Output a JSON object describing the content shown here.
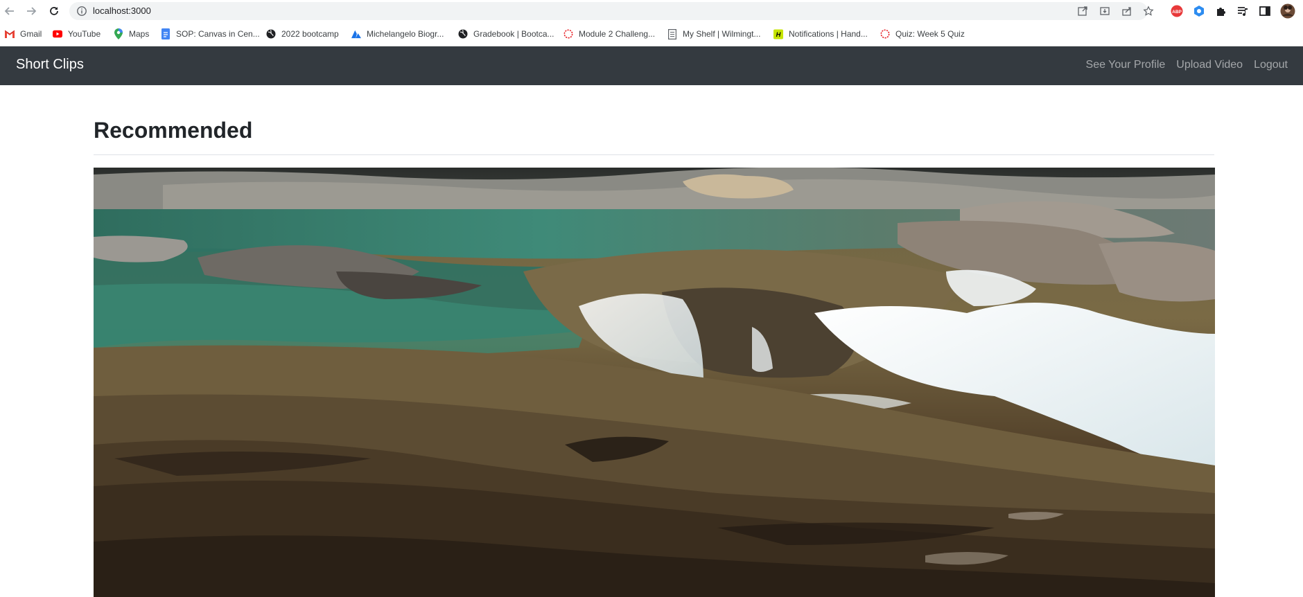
{
  "browser": {
    "url": "localhost:3000",
    "nav_icons": [
      "back-arrow-icon",
      "forward-arrow-icon",
      "reload-icon",
      "site-info-icon"
    ],
    "address_icons": [
      "open-in-app-icon",
      "install-icon",
      "share-icon",
      "star-icon"
    ],
    "extension_icons": [
      "adblock-plus-icon",
      "extension-blue-icon",
      "puzzle-icon",
      "media-queue-icon",
      "side-panel-icon",
      "profile-avatar"
    ],
    "bookmarks": [
      {
        "label": "Gmail",
        "icon": "gmail-icon",
        "color": "#ea4335"
      },
      {
        "label": "YouTube",
        "icon": "youtube-icon",
        "color": "#ff0000"
      },
      {
        "label": "Maps",
        "icon": "maps-icon",
        "color": "#34a853"
      },
      {
        "label": "SOP: Canvas in Cen...",
        "icon": "google-docs-icon",
        "color": "#4285f4"
      },
      {
        "label": "2022 bootcamp",
        "icon": "globe-icon",
        "color": "#202124"
      },
      {
        "label": "Michelangelo Biogr...",
        "icon": "biography-icon",
        "color": "#1a73e8"
      },
      {
        "label": "Gradebook | Bootca...",
        "icon": "globe-icon",
        "color": "#202124"
      },
      {
        "label": "Module 2 Challeng...",
        "icon": "canvas-icon",
        "color": "#e72429"
      },
      {
        "label": "My Shelf | Wilmingt...",
        "icon": "document-icon",
        "color": "#5f6368"
      },
      {
        "label": "Notifications | Hand...",
        "icon": "handshake-icon",
        "color": "#c6e400"
      },
      {
        "label": "Quiz: Week 5 Quiz",
        "icon": "canvas-icon",
        "color": "#e72429"
      }
    ]
  },
  "navbar": {
    "brand": "Short Clips",
    "links": [
      "See Your Profile",
      "Upload Video",
      "Logout"
    ],
    "background": "#343a40"
  },
  "main": {
    "title": "Recommended",
    "video": {
      "icon": "video-player"
    }
  }
}
